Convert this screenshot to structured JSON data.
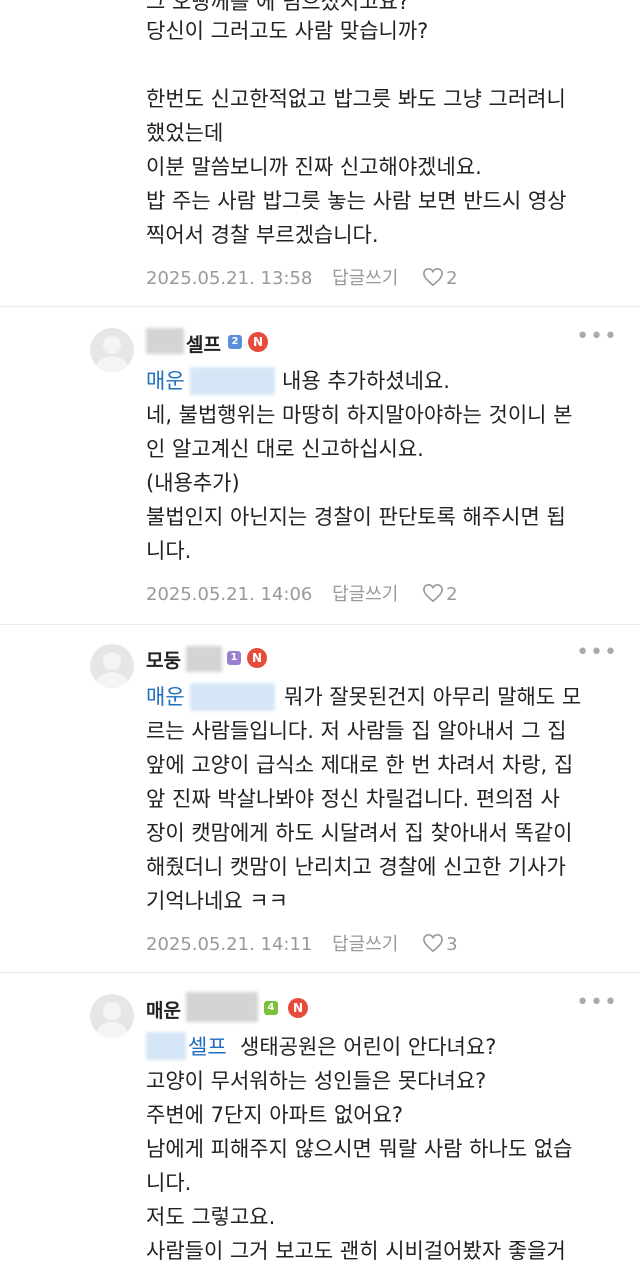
{
  "comments": [
    {
      "lines": [
        "당신이 그러고도 사람 맞습니까?",
        "",
        "한번도 신고한적없고 밥그릇 봐도 그냥 그러려니",
        "했었는데",
        "이분 말씀보니까 진짜 신고해야겠네요.",
        "밥 주는 사람 밥그릇 놓는 사람 보면 반드시 영상",
        "찍어서 경찰 부르겠습니다."
      ],
      "date": "2025.05.21. 13:58",
      "reply": "답글쓰기",
      "likes": "2"
    },
    {
      "nick_suffix": "셀프",
      "grade": "2",
      "mention": "매운",
      "first_line_rest": "내용 추가하셨네요.",
      "lines": [
        "네, 불법행위는 마땅히 하지말아야하는 것이니 본",
        "인 알고계신 대로 신고하십시요.",
        "(내용추가)",
        "불법인지 아닌지는 경찰이 판단토록 해주시면 됩",
        "니다."
      ],
      "date": "2025.05.21. 14:06",
      "reply": "답글쓰기",
      "likes": "2"
    },
    {
      "nick_prefix": "모둥",
      "grade": "1",
      "mention": "매운",
      "first_line_rest": "뭐가 잘못된건지 아무리 말해도 모",
      "lines": [
        "르는 사람들입니다. 저 사람들 집 알아내서 그 집",
        "앞에 고양이 급식소 제대로 한 번 차려서 차랑, 집",
        "앞 진짜 박살나봐야 정신 차릴겁니다. 편의점 사",
        "장이 캣맘에게 하도 시달려서 집 찾아내서 똑같이",
        "해줬더니 캣맘이 난리치고 경찰에 신고한 기사가",
        "기억나네요 ㅋㅋ"
      ],
      "date": "2025.05.21. 14:11",
      "reply": "답글쓰기",
      "likes": "3"
    },
    {
      "nick_prefix": "매운",
      "grade": "4",
      "mention": "셀프",
      "first_line_rest": "생태공원은 어린이 안다녀요?",
      "lines": [
        "고양이 무서워하는 성인들은 못다녀요?",
        "주변에 7단지 아파트 없어요?",
        "남에게 피해주지 않으시면 뭐랄 사람 하나도 없습",
        "니다.",
        "저도 그렇고요.",
        "사람들이 그거 보고도 괜히 시비걸어봤자 좋을거"
      ]
    }
  ],
  "badge_n": "N",
  "more_icon": "more-icon",
  "heart_icon": "heart-icon",
  "colors": {
    "mention": "#1f6ebf",
    "badge_n": "#e84b3c",
    "grade2": "#5b8fd8",
    "grade1": "#9b7fd0",
    "grade4": "#7bbf3a"
  }
}
